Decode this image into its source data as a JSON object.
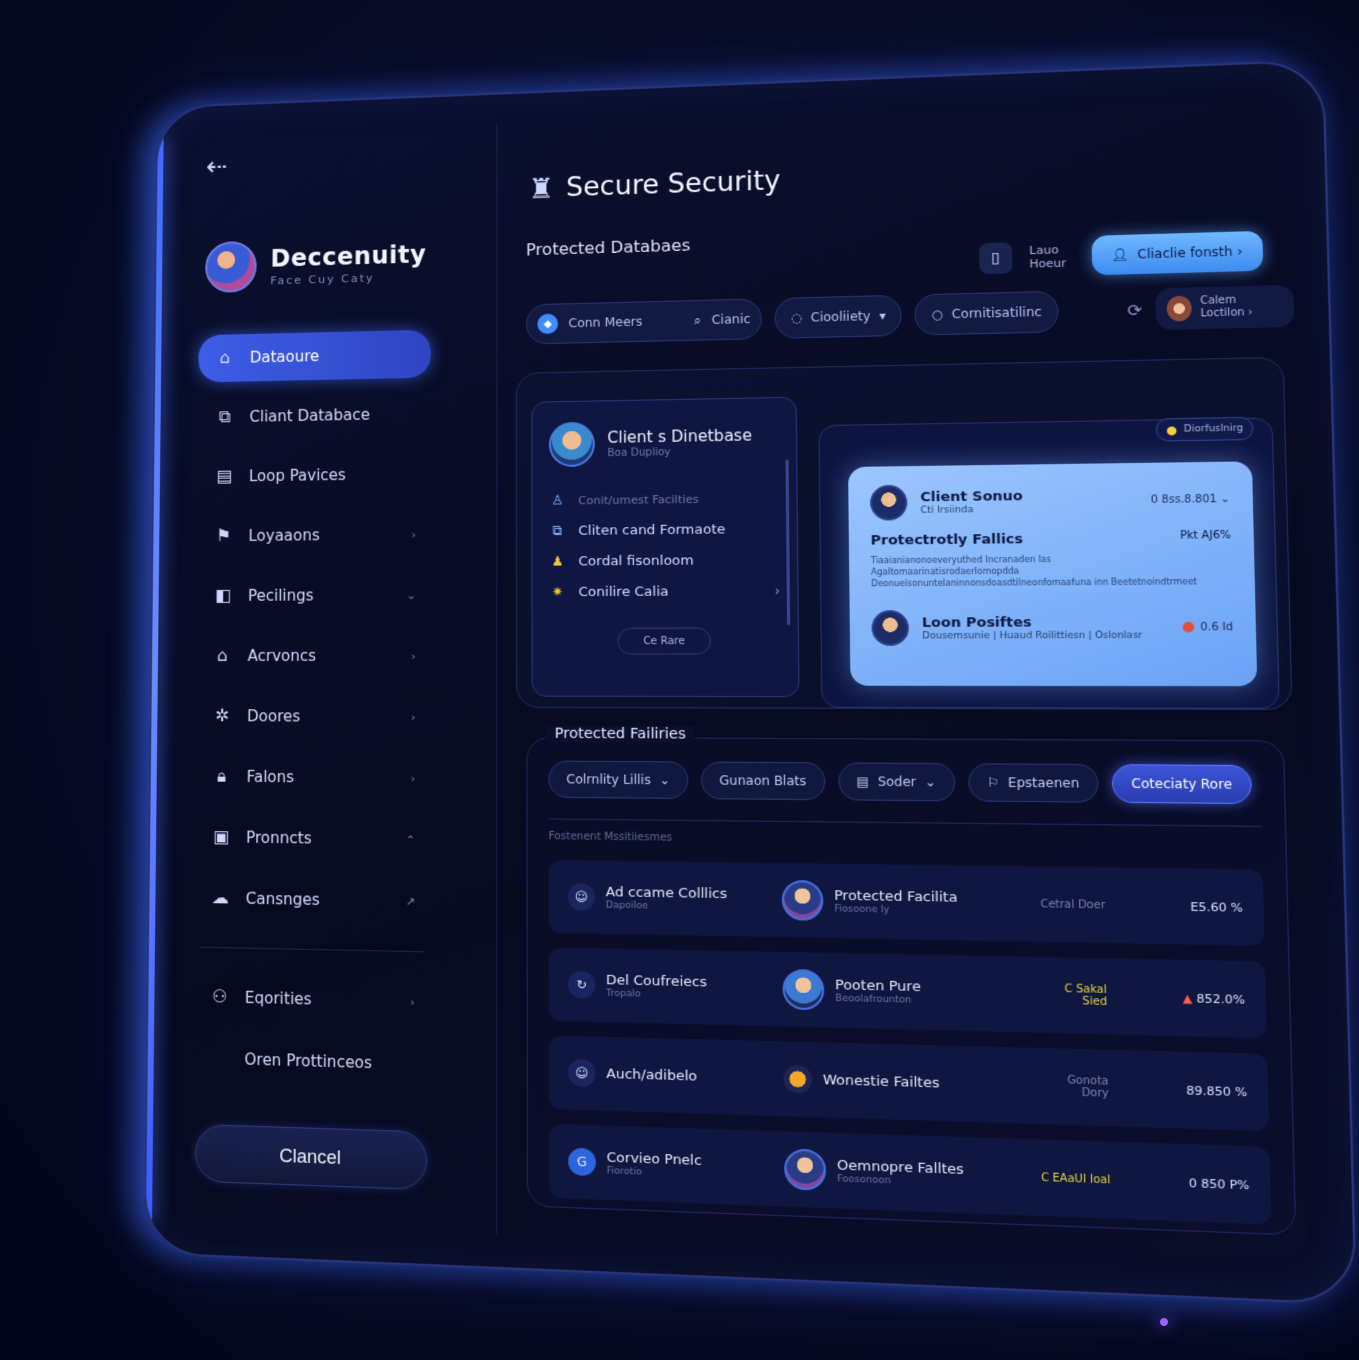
{
  "sidebar": {
    "back_icon": "arrow-left-icon",
    "brand": {
      "name": "Deccenuity",
      "sub": "Face Cuy Caty"
    },
    "items": [
      {
        "label": "Dataoure",
        "icon": "lock-icon",
        "active": true,
        "chevron": ""
      },
      {
        "label": "Cliant Databace",
        "icon": "database-icon",
        "chevron": ""
      },
      {
        "label": "Loop Pavices",
        "icon": "clipboard-icon",
        "chevron": ""
      },
      {
        "label": "Loyaaons",
        "icon": "user-run-icon",
        "chevron": "›"
      },
      {
        "label": "Pecilings",
        "icon": "folder-icon",
        "chevron": "⌄"
      },
      {
        "label": "Acrvoncs",
        "icon": "building-icon",
        "chevron": "›"
      },
      {
        "label": "Doores",
        "icon": "gear-icon",
        "chevron": "›"
      },
      {
        "label": "Falons",
        "icon": "padlock-icon",
        "chevron": "›"
      },
      {
        "label": "Pronncts",
        "icon": "document-icon",
        "chevron": "⌃"
      },
      {
        "label": "Cansnges",
        "icon": "cloud-icon",
        "chevron": "↗"
      }
    ],
    "bottom_items": [
      {
        "label": "Eqorities",
        "icon": "users-icon",
        "chevron": "›"
      },
      {
        "label": "Oren Prottinceos",
        "icon": "",
        "chevron": ""
      }
    ],
    "cancel_label": "Clancel"
  },
  "header": {
    "logo_icon": "shield-figure-icon",
    "title": "Secure Security",
    "section": "Protected Databaes",
    "top_link": "Lauo Hoeur",
    "primary_label": "Cliaclie fonsth ›"
  },
  "filters": {
    "search_placeholder": "Conn Meers",
    "search_button": "Cianic",
    "pill_1": "Ciooliiety",
    "pill_2": "Cornitisatilinc",
    "mini_user": "Calem Loctilon ›"
  },
  "client_card": {
    "title": "Client s Dinetbase",
    "sub": "Boa Duplioy",
    "dim_row": "Conit/umest Facilties",
    "rows": [
      {
        "icon": "copy-icon",
        "label": "Cliten cand Formaote"
      },
      {
        "icon": "user-icon",
        "label": "Cordal fisonloom"
      },
      {
        "icon": "star-icon",
        "label": "Conilire Calia"
      }
    ],
    "button": "Ce Rare"
  },
  "highlight": {
    "tag": "Diorfuslnirg",
    "name": "Client Sonuo",
    "name_sub": "Cti Irsiinda",
    "value": "0 8ss.8.801 ⌄",
    "heading": "Protectrotly Fallics",
    "heading_right": "Pkt AJ6%",
    "text": "Tiaaianianonoeveryuthed Incranaden Ias Agaltomaarinatisrodaerlomopdda Deonuelsonuntelaninnonsdoasdtilneonfomaafuna inn Beetetnoindtrmeet",
    "person": "Loon Posiftes",
    "person_sub": "Dousemsunie | Huaud Roilittiesn | Oslonlasr",
    "person_value": "0.6 Id"
  },
  "facilities": {
    "title": "Protected Failiries",
    "filters": [
      {
        "label": "Colrnlity Lillis",
        "caret": "⌄",
        "active": false
      },
      {
        "label": "Gunaon Blats",
        "caret": "",
        "active": false
      },
      {
        "label": "Soder",
        "caret": "⌄",
        "active": false
      },
      {
        "label": "Epstaenen",
        "caret": "",
        "active": false
      },
      {
        "label": "Coteciaty Rore",
        "caret": "",
        "active": true
      }
    ],
    "list_label": "Fostenent Mssitiiesmes",
    "rows": [
      {
        "name": "Ad ccame Colllics",
        "sub": "Dapoiloe",
        "person": "Protected Facilita",
        "person_sub": "Fiosoone ly",
        "status": "Cetral Doer",
        "value": "E5.60 %"
      },
      {
        "name": "Del Coufreiecs",
        "sub": "Tropalo",
        "person": "Pooten Pure",
        "person_sub": "Beoolafrounton",
        "status": "C Sakal Sied",
        "value": "852.0%"
      },
      {
        "name": "Auch/adibelo",
        "sub": "",
        "person": "Wonestie Failtes",
        "person_sub": "",
        "status": "Gonota Dory",
        "value": "89.850 %"
      },
      {
        "name": "Corvieo Pnelc",
        "sub": "Fiorotio",
        "person": "Oemnopre Falltes",
        "person_sub": "Foosonoon",
        "status": "C EAaUI Ioal",
        "value": "0 850 P%"
      }
    ]
  },
  "colors": {
    "accent": "#3d5ee8",
    "highlight": "#9bc6ff",
    "background": "#070b24"
  }
}
